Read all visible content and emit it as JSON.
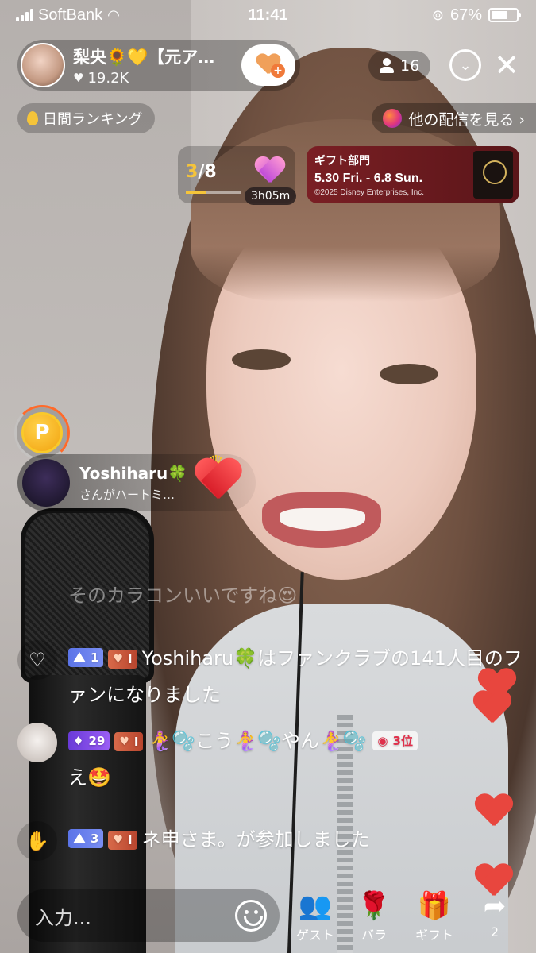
{
  "status_bar": {
    "carrier": "SoftBank",
    "time": "11:41",
    "battery": "67%"
  },
  "host": {
    "name": "梨央🌻💛【元ア…",
    "likes": "19.2K"
  },
  "header": {
    "viewer_count": "16"
  },
  "ranking": {
    "label": "日間ランキング"
  },
  "other_streams": {
    "label": "他の配信を見る ›"
  },
  "progress": {
    "current": "3",
    "total": "/8",
    "fraction": 0.375,
    "timer": "3h05m"
  },
  "event": {
    "title": "ギフト部門",
    "dates": "5.30 Fri. - 6.8 Sun.",
    "copyright": "©2025 Disney Enterprises, Inc."
  },
  "points": {
    "coin_letter": "P"
  },
  "gift_alert": {
    "user": "Yoshiharu🍀",
    "message": "さんがハートミ…"
  },
  "ghost_message": "そのカラコンいいですね😍",
  "chat": [
    {
      "level": "1",
      "fan": "I",
      "text": "Yoshiharu🍀はファンクラブの141人目のファンになりました"
    },
    {
      "level": "29",
      "fan": "I",
      "user": "🧜‍♀️🫧こう🧜‍♀️🫧やん🧜‍♀️🫧",
      "rank": "3位",
      "text": "え🤩"
    },
    {
      "level": "3",
      "fan": "I",
      "text": "ネ申さま。が参加しました"
    }
  ],
  "bottom_bar": {
    "input_placeholder": "入力...",
    "guest_label": "ゲスト",
    "rose_label": "バラ",
    "gift_label": "ギフト",
    "share_count": "2"
  },
  "colors": {
    "accent": "#f5c43a",
    "event_bg": "#7a1f24",
    "heart": "#e8463e"
  }
}
